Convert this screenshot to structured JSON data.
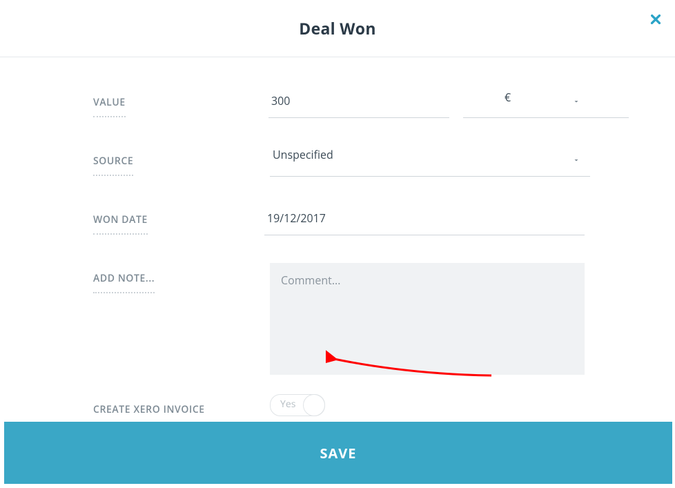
{
  "header": {
    "title": "Deal Won"
  },
  "form": {
    "value": {
      "label": "VALUE",
      "amount": "300",
      "currency": "€"
    },
    "source": {
      "label": "SOURCE",
      "value": "Unspecified"
    },
    "won_date": {
      "label": "WON DATE",
      "value": "19/12/2017"
    },
    "note": {
      "label": "ADD NOTE...",
      "placeholder": "Comment..."
    },
    "xero": {
      "label": "CREATE XERO INVOICE",
      "toggle_text": "Yes"
    }
  },
  "footer": {
    "save": "SAVE"
  }
}
